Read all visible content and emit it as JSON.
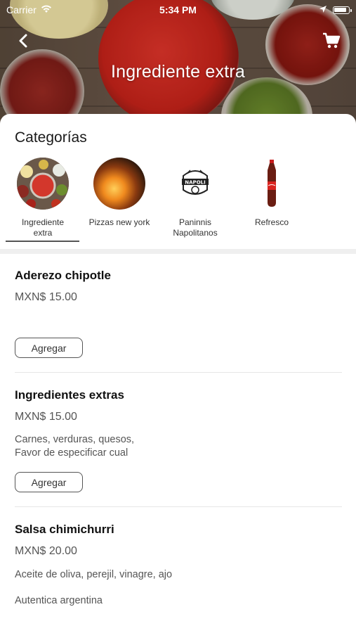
{
  "status_bar": {
    "carrier": "Carrier",
    "time": "5:34 PM"
  },
  "header": {
    "title": "Ingrediente extra",
    "back_icon": "chevron-left-icon",
    "cart_icon": "shopping-cart-icon"
  },
  "categories": {
    "title": "Categorías",
    "items": [
      {
        "label": "Ingrediente\nextra",
        "selected": true
      },
      {
        "label": "Pizzas new york",
        "selected": false
      },
      {
        "label": "Paninnis\nNapolitanos",
        "selected": false
      },
      {
        "label": "Refresco",
        "selected": false
      }
    ],
    "logo_text": "NAPOLI"
  },
  "products": [
    {
      "name": "Aderezo chipotle",
      "price": "MXN$ 15.00",
      "description": "",
      "button": "Agregar"
    },
    {
      "name": "Ingredientes extras",
      "price": "MXN$ 15.00",
      "description": "Carnes, verduras, quesos,\nFavor de especificar cual",
      "button": "Agregar"
    },
    {
      "name": "Salsa chimichurri",
      "price": "MXN$ 20.00",
      "description": "Aceite de oliva, perejil, vinagre, ajo",
      "note": "Autentica argentina"
    }
  ],
  "colors": {
    "accent_text": "#111111",
    "secondary_text": "#555555",
    "divider": "#e6e6e6"
  }
}
